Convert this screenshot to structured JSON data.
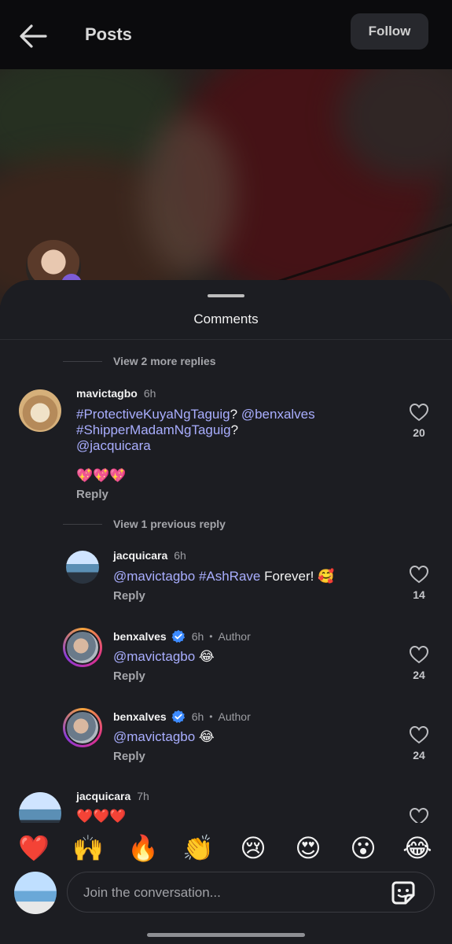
{
  "header": {
    "title": "Posts",
    "follow_label": "Follow"
  },
  "sheet": {
    "title": "Comments"
  },
  "threads": {
    "view_more_replies": "View 2 more replies",
    "view_previous_reply": "View 1 previous reply"
  },
  "comments": [
    {
      "username": "mavictagbo",
      "time": "6h",
      "line1_tag": "#ProtectiveKuyaNgTaguig",
      "line1_q": "?",
      "line1_mention": "@benxalves",
      "line2_tag": "#ShipperMadamNgTaguig",
      "line2_q": "?",
      "line3_mention": "@jacquicara",
      "emojis": "💖💖💖",
      "reply_label": "Reply",
      "likes": "20"
    },
    {
      "username": "jacquicara",
      "time": "6h",
      "mention": "@mavictagbo",
      "tag": "#AshRave",
      "text": " Forever! 🥰",
      "reply_label": "Reply",
      "likes": "14"
    },
    {
      "username": "benxalves",
      "time": "6h",
      "author_label": "Author",
      "mention": "@mavictagbo",
      "text": " 😂",
      "reply_label": "Reply",
      "likes": "24"
    },
    {
      "username": "benxalves",
      "time": "6h",
      "author_label": "Author",
      "mention": "@mavictagbo",
      "text": " 😂",
      "reply_label": "Reply",
      "likes": "24"
    },
    {
      "username": "jacquicara",
      "time": "7h",
      "text": "❤️❤️❤️"
    }
  ],
  "quick_reactions": [
    "❤️",
    "🙌",
    "🔥",
    "👏",
    "😢",
    "😍",
    "😮",
    "😂"
  ],
  "composer": {
    "placeholder": "Join the conversation..."
  },
  "colors": {
    "mention": "#a9aeff",
    "background": "#1c1d22",
    "verified": "#3d8bff"
  }
}
